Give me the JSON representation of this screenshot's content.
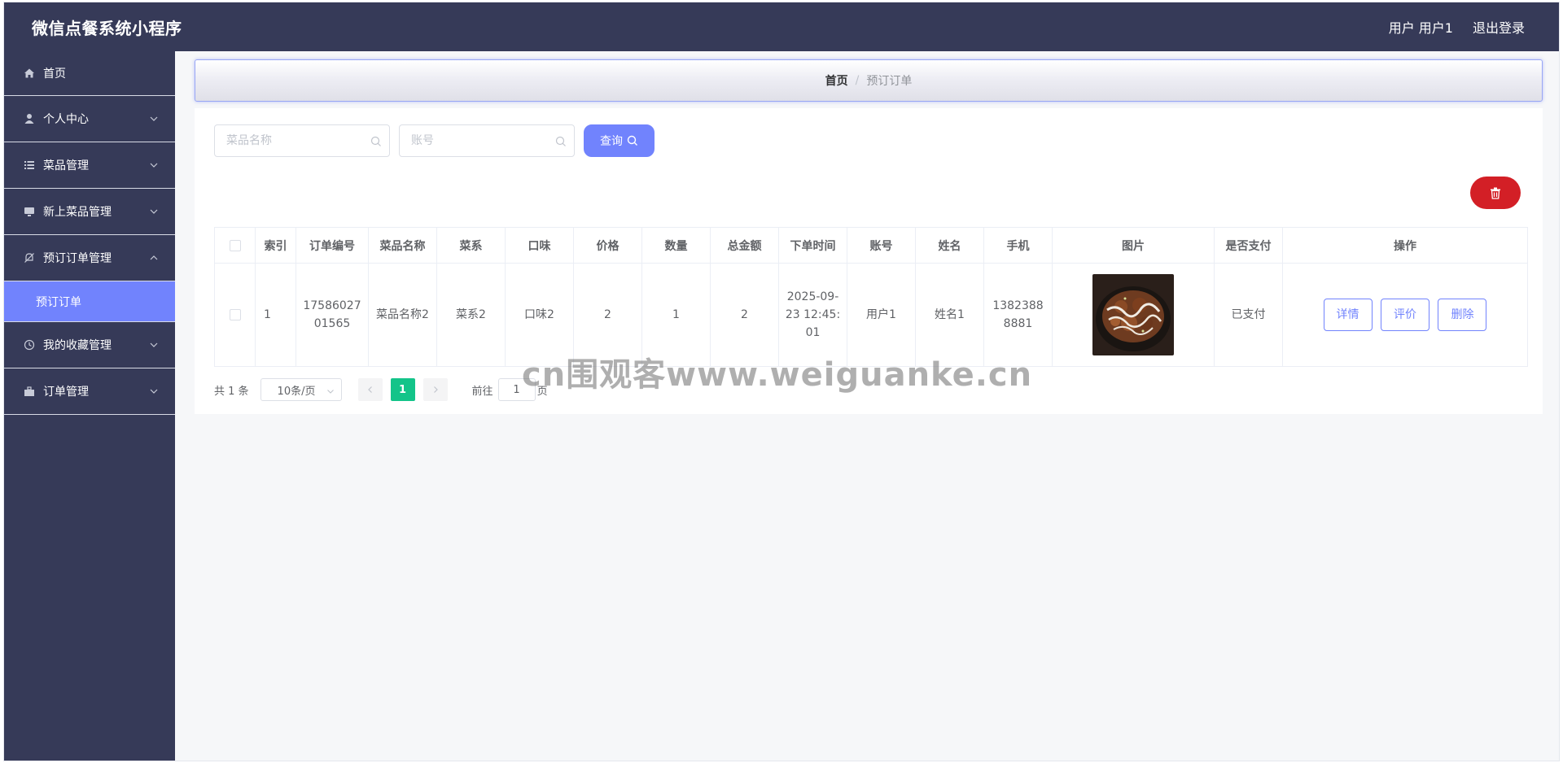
{
  "header": {
    "app_title": "微信点餐系统小程序",
    "user_label": "用户 用户1",
    "logout_label": "退出登录"
  },
  "sidebar": {
    "items": [
      {
        "label": "首页",
        "icon": "home-icon"
      },
      {
        "label": "个人中心",
        "icon": "user-icon"
      },
      {
        "label": "菜品管理",
        "icon": "list-icon"
      },
      {
        "label": "新上菜品管理",
        "icon": "monitor-icon"
      },
      {
        "label": "预订订单管理",
        "icon": "bell-off-icon",
        "expanded": true
      },
      {
        "label": "我的收藏管理",
        "icon": "clock-icon"
      },
      {
        "label": "订单管理",
        "icon": "briefcase-icon"
      }
    ],
    "submenu_item": "预订订单"
  },
  "breadcrumb": {
    "home": "首页",
    "separator": "/",
    "current": "预订订单"
  },
  "search": {
    "dish_placeholder": "菜品名称",
    "account_placeholder": "账号",
    "query_label": "查询"
  },
  "table": {
    "columns": [
      "索引",
      "订单编号",
      "菜品名称",
      "菜系",
      "口味",
      "价格",
      "数量",
      "总金额",
      "下单时间",
      "账号",
      "姓名",
      "手机",
      "图片",
      "是否支付",
      "操作"
    ],
    "rows": [
      {
        "index": "1",
        "order_no": "1758602701565",
        "dish_name": "菜品名称2",
        "cuisine": "菜系2",
        "flavor": "口味2",
        "price": "2",
        "quantity": "1",
        "total": "2",
        "order_time": "2025-09-23 12:45:01",
        "account": "用户1",
        "name": "姓名1",
        "phone": "13823888881",
        "paid": "已支付"
      }
    ],
    "actions": {
      "detail": "详情",
      "review": "评价",
      "delete": "删除"
    }
  },
  "pagination": {
    "total": "共 1 条",
    "page_size": "10条/页",
    "current_page": "1",
    "goto_label": "前往",
    "goto_value": "1",
    "goto_unit": "页"
  },
  "watermark": "cn围观客www.weiguanke.cn",
  "colors": {
    "sidebar_bg": "#363a58",
    "accent": "#7183fd",
    "danger": "#d31f26",
    "page_active": "#13c489"
  }
}
